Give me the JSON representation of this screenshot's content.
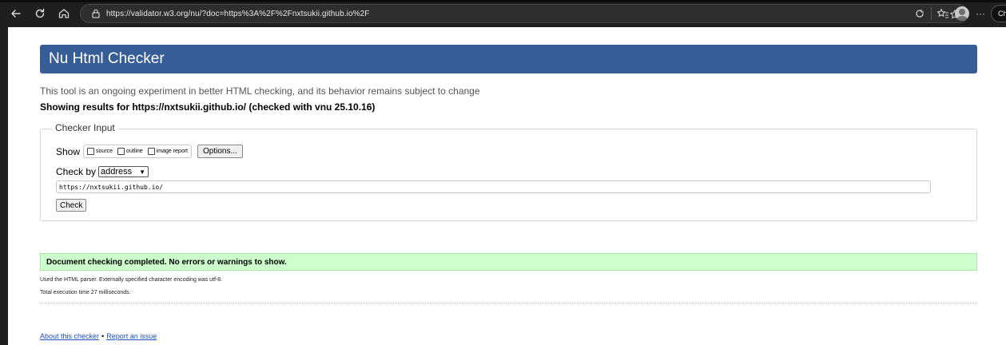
{
  "browser": {
    "url": "https://validator.w3.org/nu/?doc=https%3A%2F%2Fnxtsukii.github.io%2F",
    "chat_label": "Chat",
    "more_label": "···",
    "icons": {
      "back": "back-arrow-icon",
      "refresh": "refresh-icon",
      "home": "home-icon",
      "lock": "lock-icon",
      "favorite": "star-icon",
      "extensions": "extensions-icon",
      "favorites_bar": "favorites-icon",
      "profile": "avatar",
      "copilot": "copilot-icon"
    }
  },
  "page": {
    "title": "Nu Html Checker",
    "intro": "This tool is an ongoing experiment in better HTML checking, and its behavior remains subject to change",
    "results_line": "Showing results for https://nxtsukii.github.io/ (checked with vnu 25.10.16)",
    "checker_input": {
      "legend": "Checker Input",
      "show_label": "Show",
      "checkboxes": [
        {
          "label": "source",
          "checked": false
        },
        {
          "label": "outline",
          "checked": false
        },
        {
          "label": "image report",
          "checked": false
        }
      ],
      "options_button": "Options...",
      "check_by_label": "Check by",
      "check_by_value": "address",
      "url_value": "https://nxtsukii.github.io/",
      "check_button": "Check"
    },
    "result": {
      "message": "Document checking completed. No errors or warnings to show.",
      "parser_info": "Used the HTML parser. Externally specified character encoding was utf-8.",
      "exec_time": "Total execution time 27 milliseconds."
    },
    "footer": {
      "about_link": "About this checker",
      "separator": "•",
      "report_link": "Report an issue"
    }
  },
  "colors": {
    "banner": "#365d95",
    "success_bg": "#ccffcc",
    "link": "#1a4fbf"
  }
}
